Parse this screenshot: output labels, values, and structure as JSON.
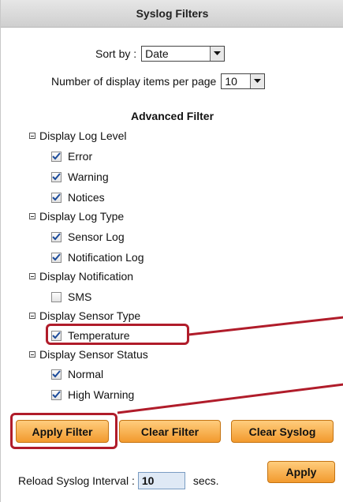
{
  "header": {
    "title": "Syslog Filters"
  },
  "sort": {
    "label": "Sort by :",
    "value": "Date"
  },
  "per_page": {
    "label": "Number of display items per page",
    "value": "10"
  },
  "advanced": {
    "title": "Advanced Filter",
    "groups": [
      {
        "label": "Display Log Level",
        "items": [
          {
            "label": "Error",
            "checked": true
          },
          {
            "label": "Warning",
            "checked": true
          },
          {
            "label": "Notices",
            "checked": true
          }
        ]
      },
      {
        "label": "Display Log Type",
        "items": [
          {
            "label": "Sensor Log",
            "checked": true
          },
          {
            "label": "Notification Log",
            "checked": true
          }
        ]
      },
      {
        "label": "Display Notification",
        "items": [
          {
            "label": "SMS",
            "checked": false
          }
        ]
      },
      {
        "label": "Display Sensor Type",
        "items": [
          {
            "label": "Temperature",
            "checked": true
          }
        ]
      },
      {
        "label": "Display Sensor Status",
        "items": [
          {
            "label": "Normal",
            "checked": true
          },
          {
            "label": "High Warning",
            "checked": true
          }
        ]
      }
    ]
  },
  "buttons": {
    "apply_filter": "Apply Filter",
    "clear_filter": "Clear Filter",
    "clear_syslog": "Clear Syslog"
  },
  "reload": {
    "label": "Reload Syslog Interval :",
    "value": "10",
    "unit": "secs.",
    "apply": "Apply"
  },
  "colors": {
    "accent_orange": "#f29a2e",
    "highlight_red": "#b01c2a"
  }
}
